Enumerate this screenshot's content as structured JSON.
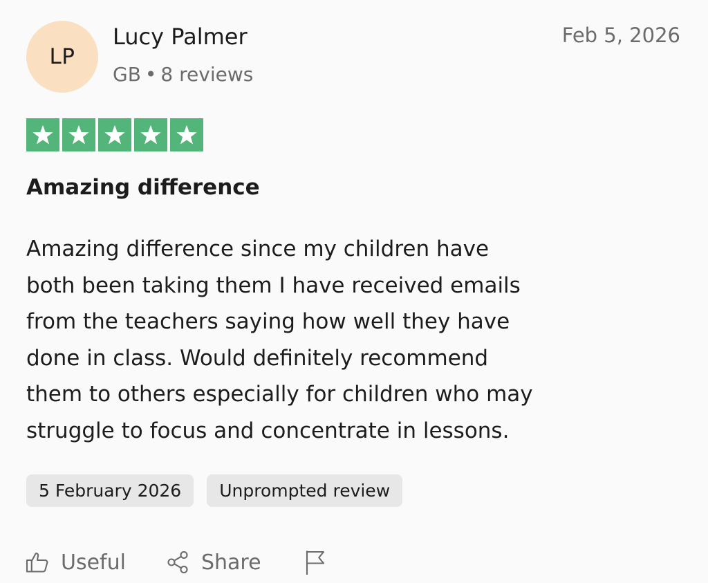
{
  "reviewer": {
    "initials": "LP",
    "name": "Lucy Palmer",
    "country": "GB",
    "separator": "•",
    "reviews_count": "8 reviews",
    "avatar_color": "#fae0c1"
  },
  "review": {
    "date_short": "Feb 5, 2026",
    "rating": 5,
    "rating_max": 5,
    "star_color": "#54b57b",
    "title": "Amazing difference",
    "body_lines": [
      "Amazing difference since my children have",
      "both been taking them I have received emails",
      "from the teachers saying how well they have",
      "done in class. Would definitely recommend",
      "them to others especially for children who may",
      "struggle to focus and concentrate in lessons."
    ]
  },
  "tags": {
    "date_long": "5 February 2026",
    "label": "Unprompted review"
  },
  "actions": {
    "useful_label": "Useful",
    "useful_icon": "thumbs-up-icon",
    "share_label": "Share",
    "share_icon": "share-icon",
    "report_icon": "flag-icon"
  }
}
